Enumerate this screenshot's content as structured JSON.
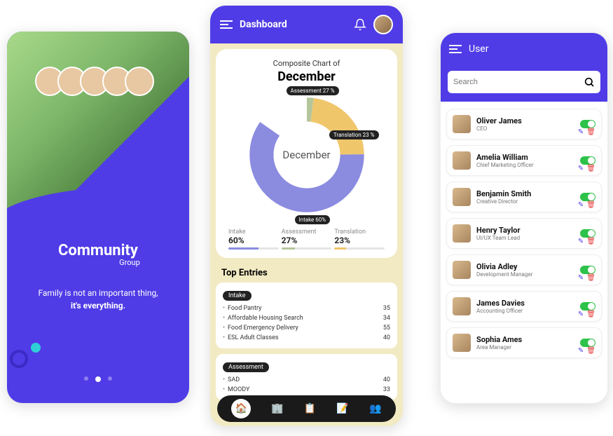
{
  "splash": {
    "logo_main": "Community",
    "logo_sub": "Group",
    "tagline_line1": "Family is not an important thing,",
    "tagline_line2": "it's everything."
  },
  "dashboard": {
    "header_title": "Dashboard",
    "chart_super": "Composite Chart of",
    "chart_month": "December",
    "chart_center": "December",
    "labels": {
      "assessment": "Assessment  27 %",
      "translation": "Translation  23 %",
      "intake": "Intake  60%"
    },
    "legend": [
      {
        "label": "Intake",
        "value": "60%"
      },
      {
        "label": "Assessment",
        "value": "27%"
      },
      {
        "label": "Translation",
        "value": "23%"
      }
    ],
    "top_entries_title": "Top Entries",
    "sections": [
      {
        "name": "Intake",
        "rows": [
          {
            "label": "Food Pantry",
            "value": "35"
          },
          {
            "label": "Affordable Housing Search",
            "value": "34"
          },
          {
            "label": "Food Emergency Delivery",
            "value": "55"
          },
          {
            "label": "ESL Adult Classes",
            "value": "40"
          }
        ]
      },
      {
        "name": "Assessment",
        "rows": [
          {
            "label": "SAD",
            "value": "40"
          },
          {
            "label": "MOODY",
            "value": "33"
          }
        ]
      }
    ]
  },
  "users": {
    "header_title": "User",
    "search_placeholder": "Search",
    "list": [
      {
        "name": "Oliver James",
        "role": "CEO"
      },
      {
        "name": "Amelia William",
        "role": "Chief Marketing Officer"
      },
      {
        "name": "Benjamin Smith",
        "role": "Creative Director"
      },
      {
        "name": "Henry Taylor",
        "role": "UI/UX Team Lead"
      },
      {
        "name": "Olivia Adley",
        "role": "Development Manager"
      },
      {
        "name": "James Davies",
        "role": "Accounting Officer"
      },
      {
        "name": "Sophia Ames",
        "role": "Area Manager"
      }
    ]
  },
  "chart_data": {
    "type": "pie",
    "title": "Composite Chart of December",
    "series": [
      {
        "name": "Intake",
        "value": 60,
        "color": "#8b8be0"
      },
      {
        "name": "Assessment",
        "value": 27,
        "color": "#b5c59b"
      },
      {
        "name": "Translation",
        "value": 23,
        "color": "#f0c66b"
      }
    ]
  },
  "colors": {
    "primary": "#4f3ce6",
    "bg2": "#f2eac3",
    "toggle_on": "#2ec24a"
  }
}
